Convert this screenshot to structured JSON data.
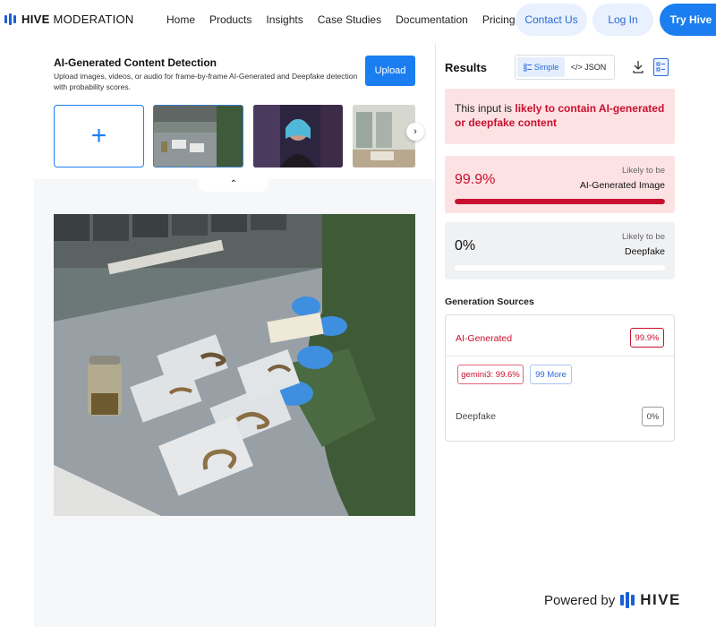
{
  "header": {
    "logo_bold": "HIVE",
    "logo_light": " MODERATION",
    "nav": [
      "Home",
      "Products",
      "Insights",
      "Case Studies",
      "Documentation",
      "Pricing"
    ],
    "contact_label": "Contact Us",
    "login_label": "Log In",
    "try_label": "Try Hive"
  },
  "detector": {
    "title": "AI-Generated Content Detection",
    "description": "Upload images, videos, or audio for frame-by-frame AI-Generated and Deepfake detection with probability scores.",
    "upload_label": "Upload",
    "add_glyph": "+",
    "next_glyph": "›",
    "collapse_glyph": "⌃"
  },
  "results": {
    "title": "Results",
    "toggle_simple": "Simple",
    "toggle_json": "</> JSON",
    "alert_prefix": "This input is ",
    "alert_highlight": "likely to contain AI-generated or deepfake content",
    "scores": [
      {
        "percent": "99.9%",
        "likely": "Likely to be",
        "label": "AI-Generated Image",
        "fill": 0.999
      },
      {
        "percent": "0%",
        "likely": "Likely to be",
        "label": "Deepfake",
        "fill": 0
      }
    ],
    "generation_title": "Generation Sources",
    "ai_label": "AI-Generated",
    "ai_value": "99.9%",
    "source_chip": "gemini3: 99.6%",
    "more_chip": "99 More",
    "deepfake_label": "Deepfake",
    "deepfake_value": "0%"
  },
  "footer": {
    "powered_by": "Powered by",
    "brand": "HIVE"
  },
  "colors": {
    "accent": "#1b7ef0",
    "alert": "#c8102e"
  }
}
